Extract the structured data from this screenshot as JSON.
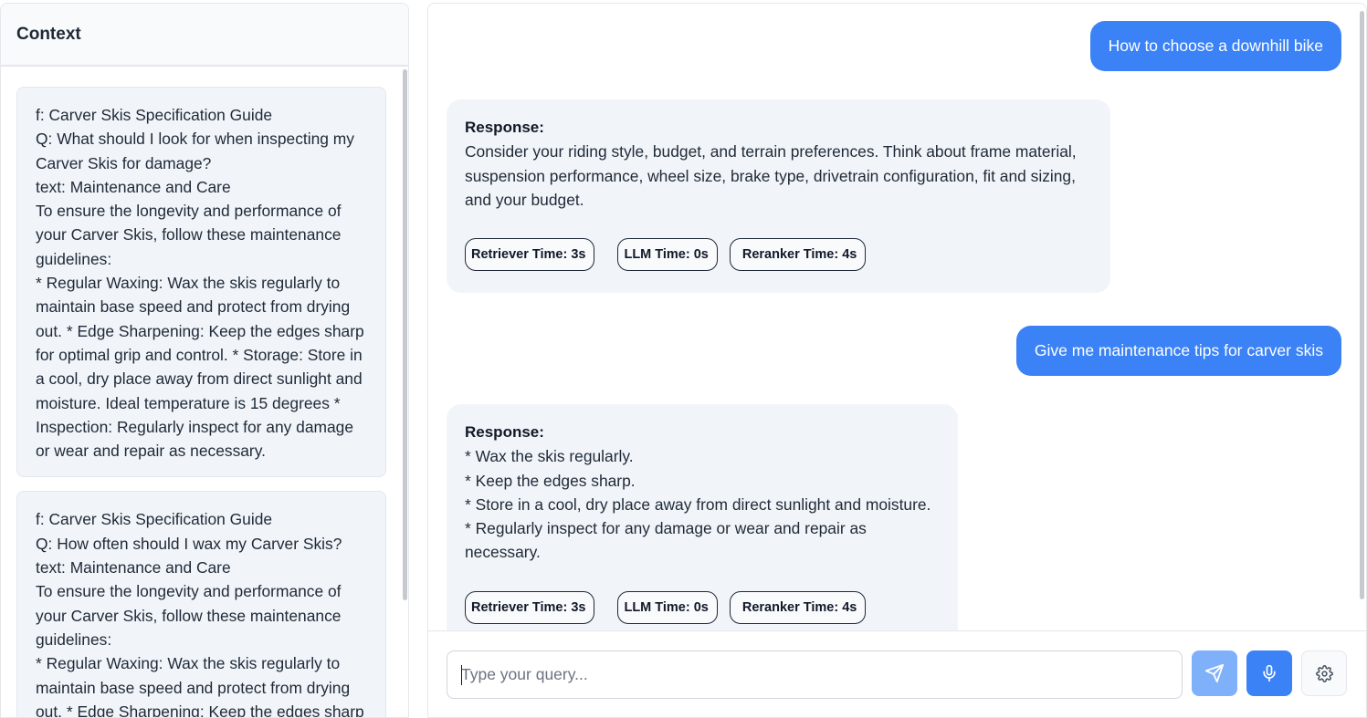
{
  "sidebar": {
    "title": "Context",
    "cards": [
      {
        "lines": [
          "f: Carver Skis Specification Guide",
          "Q: What should I look for when inspecting my",
          "Carver Skis for damage?",
          "text: Maintenance and Care",
          "To ensure the longevity and performance of",
          "your Carver Skis, follow these maintenance",
          "guidelines:",
          "* Regular Waxing: Wax the skis regularly to",
          "maintain base speed and protect from drying",
          "out. * Edge Sharpening: Keep the edges sharp",
          "for optimal grip and control. * Storage: Store in",
          "a cool, dry place away from direct sunlight and",
          "moisture. Ideal temperature is 15 degrees *",
          "Inspection: Regularly inspect for any damage",
          "or wear and repair as necessary."
        ]
      },
      {
        "lines": [
          "f: Carver Skis Specification Guide",
          "Q: How often should I wax my Carver Skis?",
          "text: Maintenance and Care",
          "To ensure the longevity and performance of",
          "your Carver Skis, follow these maintenance",
          "guidelines:",
          "* Regular Waxing: Wax the skis regularly to",
          "maintain base speed and protect from drying",
          "out. * Edge Sharpening: Keep the edges sharp"
        ]
      }
    ]
  },
  "chat": {
    "messages": [
      {
        "role": "user",
        "text": "How to choose a downhill bike"
      },
      {
        "role": "bot",
        "label": "Response:",
        "lines": [
          "Consider your riding style, budget, and terrain preferences.  Think about frame material,",
          "suspension performance, wheel size, brake type, drivetrain configuration, fit and sizing,",
          "and your budget."
        ],
        "badges": [
          "Retriever Time: 3s",
          "LLM Time: 0s",
          "Reranker Time: 4s"
        ]
      },
      {
        "role": "user",
        "text": "Give me maintenance tips for carver skis"
      },
      {
        "role": "bot",
        "label": "Response:",
        "lines": [
          "* Wax the skis regularly.",
          "* Keep the edges sharp.",
          "* Store in a cool, dry place away from direct sunlight and moisture.",
          "* Regularly inspect for any damage or wear and repair as necessary."
        ],
        "badges": [
          "Retriever Time: 3s",
          "LLM Time: 0s",
          "Reranker Time: 4s"
        ]
      }
    ]
  },
  "input": {
    "placeholder": "Type your query...",
    "value": ""
  },
  "icons": {
    "send": "send-icon",
    "mic": "microphone-icon",
    "settings": "gear-icon"
  },
  "colors": {
    "accent": "#3b82f6",
    "send_disabled": "#7fb1fb",
    "bubble_bg": "#f1f5f9"
  }
}
